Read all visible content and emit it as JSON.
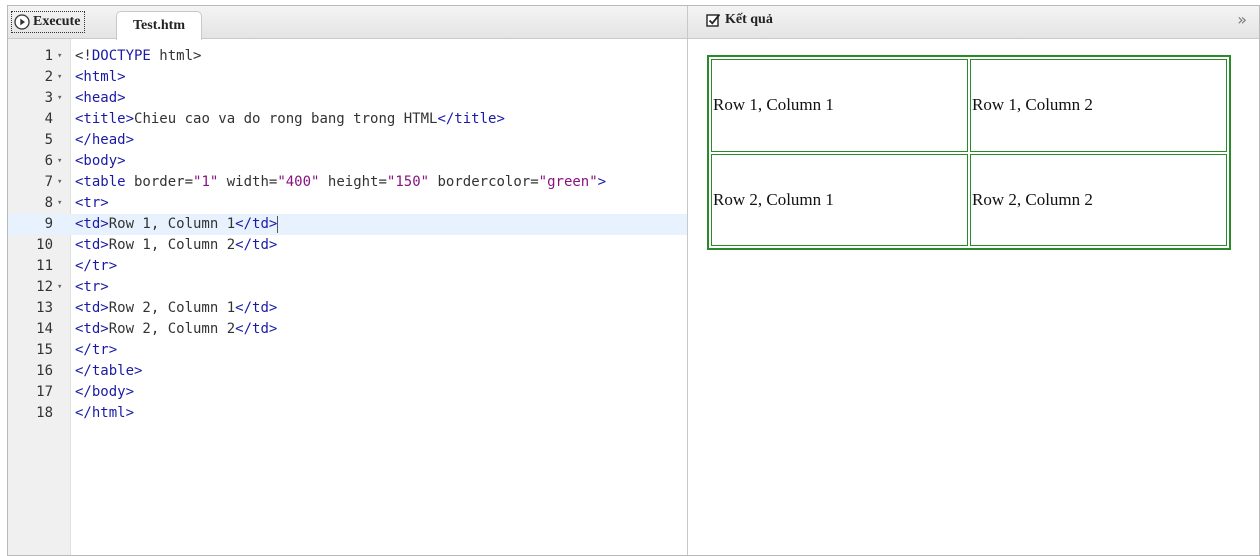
{
  "toolbar": {
    "execute_label": "Execute",
    "file_tab": "Test.htm"
  },
  "result": {
    "title": "Kết quả",
    "expand_glyph": "»",
    "rows": [
      [
        "Row 1, Column 1",
        "Row 1, Column 2"
      ],
      [
        "Row 2, Column 1",
        "Row 2, Column 2"
      ]
    ]
  },
  "editor": {
    "lines": [
      {
        "n": "1",
        "fold": true,
        "html": "<span class='a'>&lt;!</span><span class='t'>DOCTYPE</span> html&gt;"
      },
      {
        "n": "2",
        "fold": true,
        "html": "<span class='t'>&lt;html&gt;</span>"
      },
      {
        "n": "3",
        "fold": true,
        "html": "<span class='t'>&lt;head&gt;</span>"
      },
      {
        "n": "4",
        "fold": false,
        "html": "<span class='t'>&lt;title&gt;</span>Chieu cao va do rong bang trong HTML<span class='t'>&lt;/title&gt;</span>"
      },
      {
        "n": "5",
        "fold": false,
        "html": "<span class='t'>&lt;/head&gt;</span>"
      },
      {
        "n": "6",
        "fold": true,
        "html": "<span class='t'>&lt;body&gt;</span>"
      },
      {
        "n": "7",
        "fold": true,
        "html": "<span class='t'>&lt;table</span> border=<span class='v'>\"1\"</span> width=<span class='v'>\"400\"</span> height=<span class='v'>\"150\"</span> bordercolor=<span class='v'>\"green\"</span><span class='t'>&gt;</span>"
      },
      {
        "n": "8",
        "fold": true,
        "html": "<span class='t'>&lt;tr&gt;</span>"
      },
      {
        "n": "9",
        "fold": false,
        "active": true,
        "html": "<span class='t'>&lt;td&gt;</span>Row 1, Column 1<span class='t'>&lt;/td&gt;</span><span class='cursor'></span>"
      },
      {
        "n": "10",
        "fold": false,
        "html": "<span class='t'>&lt;td&gt;</span>Row 1, Column 2<span class='t'>&lt;/td&gt;</span>"
      },
      {
        "n": "11",
        "fold": false,
        "html": "<span class='t'>&lt;/tr&gt;</span>"
      },
      {
        "n": "12",
        "fold": true,
        "html": "<span class='t'>&lt;tr&gt;</span>"
      },
      {
        "n": "13",
        "fold": false,
        "html": "<span class='t'>&lt;td&gt;</span>Row 2, Column 1<span class='t'>&lt;/td&gt;</span>"
      },
      {
        "n": "14",
        "fold": false,
        "html": "<span class='t'>&lt;td&gt;</span>Row 2, Column 2<span class='t'>&lt;/td&gt;</span>"
      },
      {
        "n": "15",
        "fold": false,
        "html": "<span class='t'>&lt;/tr&gt;</span>"
      },
      {
        "n": "16",
        "fold": false,
        "html": "<span class='t'>&lt;/table&gt;</span>"
      },
      {
        "n": "17",
        "fold": false,
        "html": "<span class='t'>&lt;/body&gt;</span>"
      },
      {
        "n": "18",
        "fold": false,
        "html": "<span class='t'>&lt;/html&gt;</span>"
      }
    ]
  }
}
